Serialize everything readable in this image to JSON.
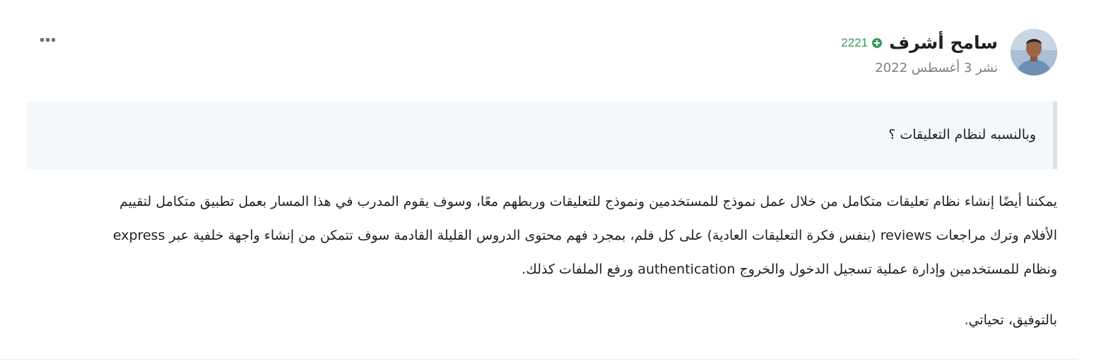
{
  "author": {
    "name": "سامح أشرف",
    "reputation": "2221",
    "reputation_icon": "plus-circle-icon",
    "avatar_icon": "user-avatar"
  },
  "post": {
    "date": "نشر 3 أغسطس 2022",
    "menu_icon": "more-options-icon",
    "quote": "وبالنسبه لنظام التعليقات ؟",
    "body_lines": [
      "يمكننا أيضًا إنشاء نظام تعليقات متكامل من خلال عمل نموذج للمستخدمين ونموذج للتعليقات وربطهم معًا، وسوف يقوم المدرب في هذا المسار بعمل تطبيق متكامل لتقييم",
      "الأفلام وترك مراجعات reviews (بنفس فكرة التعليقات العادية) على كل فلم، بمجرد فهم محتوى الدروس القليلة القادمة سوف تتمكن من إنشاء واجهة خلفية عبر express",
      "ونظام للمستخدمين وإدارة عملية تسجيل الدخول والخروج authentication ورفع الملفات كذلك."
    ],
    "signoff": "بالتوفيق، تحياتي."
  },
  "colors": {
    "reputation": "#3a9a5c",
    "quote_background": "#f5f8fb",
    "quote_border": "#dde1e6",
    "meta_text": "#7a7f87"
  }
}
